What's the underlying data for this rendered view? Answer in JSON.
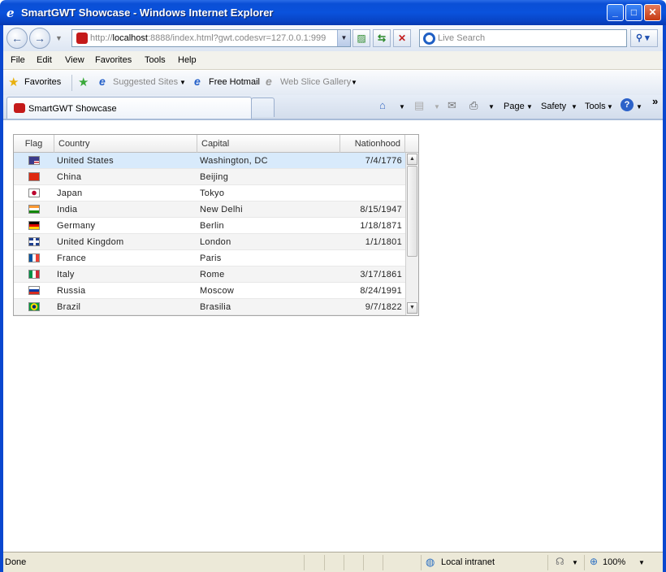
{
  "window": {
    "title": "SmartGWT Showcase - Windows Internet Explorer",
    "minimize_icon": "minimize-icon",
    "maximize_icon": "maximize-icon",
    "close_icon": "close-icon"
  },
  "address_bar": {
    "prefix": "http://",
    "host": "localhost",
    "rest": ":8888/index.html?gwt.codesvr=127.0.0.1:999"
  },
  "search": {
    "placeholder": "Live Search"
  },
  "menu": [
    "File",
    "Edit",
    "View",
    "Favorites",
    "Tools",
    "Help"
  ],
  "favorites_bar": {
    "favorites": "Favorites",
    "suggested_sites": "Suggested Sites",
    "free_hotmail": "Free Hotmail",
    "web_slice_gallery": "Web Slice Gallery"
  },
  "tab": {
    "label": "SmartGWT Showcase"
  },
  "command_bar": {
    "page": "Page",
    "safety": "Safety",
    "tools": "Tools",
    "chevron": "»"
  },
  "grid": {
    "columns": [
      "Flag",
      "Country",
      "Capital",
      "Nationhood"
    ],
    "rows": [
      {
        "flag": "us",
        "country": "United States",
        "capital": "Washington, DC",
        "nationhood": "7/4/1776"
      },
      {
        "flag": "cn",
        "country": "China",
        "capital": "Beijing",
        "nationhood": ""
      },
      {
        "flag": "jp",
        "country": "Japan",
        "capital": "Tokyo",
        "nationhood": ""
      },
      {
        "flag": "in",
        "country": "India",
        "capital": "New Delhi",
        "nationhood": "8/15/1947"
      },
      {
        "flag": "de",
        "country": "Germany",
        "capital": "Berlin",
        "nationhood": "1/18/1871"
      },
      {
        "flag": "gb",
        "country": "United Kingdom",
        "capital": "London",
        "nationhood": "1/1/1801"
      },
      {
        "flag": "fr",
        "country": "France",
        "capital": "Paris",
        "nationhood": ""
      },
      {
        "flag": "it",
        "country": "Italy",
        "capital": "Rome",
        "nationhood": "3/17/1861"
      },
      {
        "flag": "ru",
        "country": "Russia",
        "capital": "Moscow",
        "nationhood": "8/24/1991"
      },
      {
        "flag": "br",
        "country": "Brazil",
        "capital": "Brasilia",
        "nationhood": "9/7/1822"
      }
    ]
  },
  "status_bar": {
    "status": "Done",
    "zone": "Local intranet",
    "zoom": "100%"
  }
}
